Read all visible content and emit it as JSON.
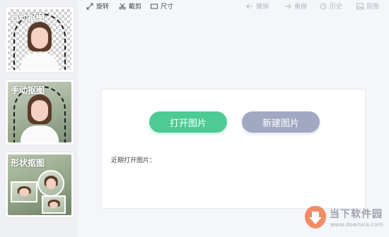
{
  "sidebar": {
    "modes": [
      {
        "label": "自动抠图"
      },
      {
        "label": "手动抠图"
      },
      {
        "label": "形状抠图"
      }
    ]
  },
  "toolbar": {
    "rotate": "旋转",
    "crop": "截剪",
    "size": "尺寸",
    "undo": "撤销",
    "redo": "重做",
    "history": "历史",
    "original": "原图"
  },
  "main": {
    "open_image": "打开图片",
    "new_image": "新建图片",
    "recent_label": "近期打开图片："
  },
  "watermark": {
    "title": "当下软件园",
    "url": "www.downxia.com"
  },
  "colors": {
    "accent_green": "#4ccb94",
    "accent_gray": "#a2a8c2"
  }
}
